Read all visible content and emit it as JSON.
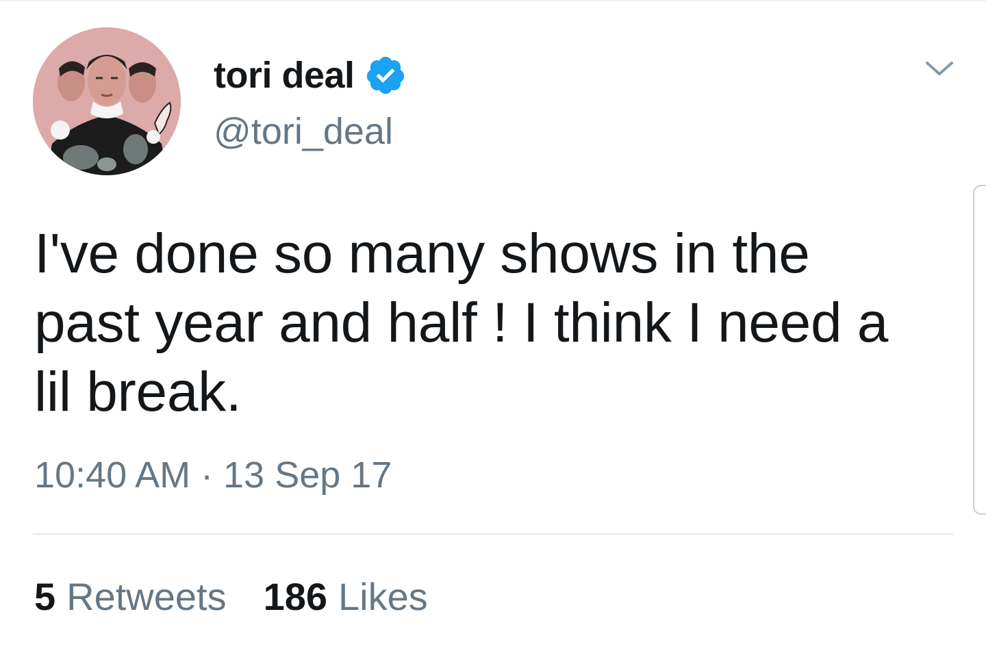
{
  "tweet": {
    "author": {
      "display_name": "tori deal",
      "handle": "@tori_deal",
      "verified": true
    },
    "text_lines": [
      "I've done so many shows in the",
      "past year and half ! I think I need a",
      "lil break."
    ],
    "timestamp": "10:40 AM · 13 Sep 17",
    "stats": {
      "retweets_count": "5",
      "retweets_label": "Retweets",
      "likes_count": "186",
      "likes_label": "Likes"
    }
  },
  "icons": {
    "verified": "verified-badge-icon",
    "menu": "chevron-down-icon"
  },
  "colors": {
    "text_primary": "#14171a",
    "text_secondary": "#657786",
    "verified_blue": "#1da1f2",
    "divider": "#e1e8ed",
    "avatar_background": "#d9a9a9"
  }
}
